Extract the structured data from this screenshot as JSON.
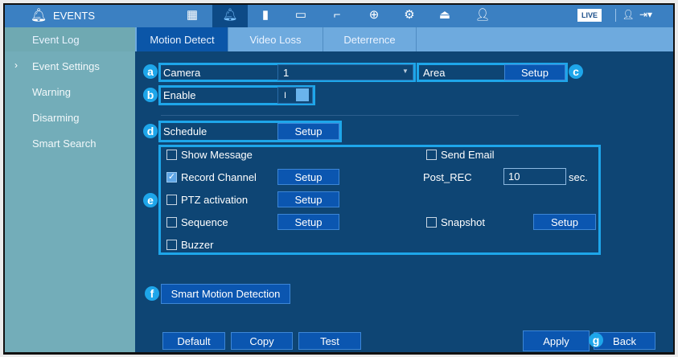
{
  "header": {
    "title": "EVENTS",
    "live_label": "LIVE",
    "icons": [
      "playback-icon",
      "events-bell-icon",
      "storage-icon",
      "display-icon",
      "camera-icon",
      "network-icon",
      "settings-gears-icon",
      "backup-icon",
      "user-icon"
    ]
  },
  "tabs": [
    {
      "label": "Event Log"
    },
    {
      "label": "Motion Detect"
    },
    {
      "label": "Video Loss"
    },
    {
      "label": "Deterrence"
    }
  ],
  "sidebar": {
    "items": [
      {
        "label": "Event Settings",
        "active": true
      },
      {
        "label": "Warning"
      },
      {
        "label": "Disarming"
      },
      {
        "label": "Smart Search"
      }
    ]
  },
  "form": {
    "camera_label": "Camera",
    "camera_value": "1",
    "area_label": "Area",
    "area_button": "Setup",
    "enable_label": "Enable",
    "enable_value": "I",
    "schedule_label": "Schedule",
    "schedule_button": "Setup",
    "show_message": "Show Message",
    "send_email": "Send Email",
    "record_channel": "Record Channel",
    "record_button": "Setup",
    "post_rec_label": "Post_REC",
    "post_rec_value": "10",
    "post_rec_unit": "sec.",
    "ptz": "PTZ activation",
    "ptz_button": "Setup",
    "sequence": "Sequence",
    "sequence_button": "Setup",
    "snapshot": "Snapshot",
    "snapshot_button": "Setup",
    "buzzer": "Buzzer",
    "smart_motion": "Smart Motion Detection"
  },
  "footer": {
    "default": "Default",
    "copy": "Copy",
    "test": "Test",
    "apply": "Apply",
    "back": "Back"
  },
  "callouts": {
    "a": "a",
    "b": "b",
    "c": "c",
    "d": "d",
    "e": "e",
    "f": "f",
    "g": "g"
  }
}
